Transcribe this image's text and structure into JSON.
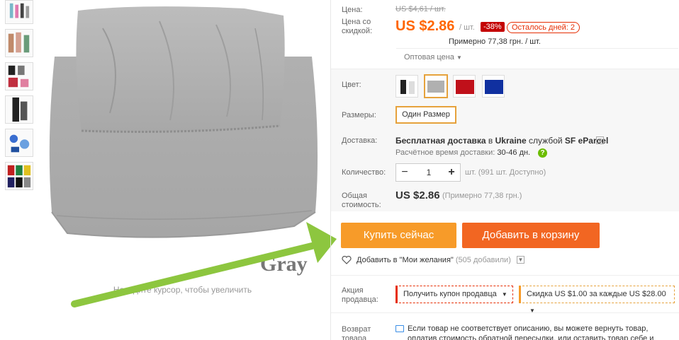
{
  "product": {
    "zoom_hint": "Наведите курсор, чтобы увеличить",
    "image_text": "Gray"
  },
  "pricing": {
    "price_label": "Цена:",
    "old_price": "US $4,61 / шт.",
    "discount_label": "Цена со скидкой:",
    "new_price": "US $2.86",
    "per_unit": "/ шт.",
    "discount_badge": "-38%",
    "days_left": "Осталось дней: 2",
    "approx": "Примерно 77,38 грн. / шт.",
    "wholesale": "Оптовая цена"
  },
  "options": {
    "color_label": "Цвет:",
    "colors": [
      "black-white",
      "gray",
      "red",
      "blue"
    ],
    "selected_color": 1,
    "size_label": "Размеры:",
    "size_value": "Один Размер"
  },
  "shipping": {
    "label": "Доставка:",
    "text_prefix": "Бесплатная доставка",
    "text_middle": "в",
    "country": "Ukraine",
    "text_service_prefix": "службой",
    "service": "SF eParcel",
    "eta_label": "Расчётное время доставки:",
    "eta_value": "30-46 дн."
  },
  "quantity": {
    "label": "Количество:",
    "value": "1",
    "available": "шт. (991 шт. Доступно)"
  },
  "total": {
    "label": "Общая стоимость:",
    "price": "US $2.86",
    "approx": "(Примерно 77,38 грн.)"
  },
  "actions": {
    "buy_now": "Купить сейчас",
    "add_to_cart": "Добавить в корзину",
    "wishlist": "Добавить в \"Мои желания\"",
    "wishlist_count": "(505 добавили)"
  },
  "promo": {
    "label": "Акция продавца:",
    "coupon": "Получить купон продавца",
    "discount": "Скидка US $1.00 за каждые US $28.00"
  },
  "returns": {
    "label": "Возврат товара",
    "text": "Если товар не соответствует описанию, вы можете вернуть товар, оплатив стоимость обратной пересылки, или оставить товар себе и"
  },
  "colors": {
    "accent_orange": "#f60",
    "buy_button": "#f79b29",
    "cart_button": "#f26622",
    "arrow_green": "#8dc63f",
    "badge_red": "#c40000"
  }
}
